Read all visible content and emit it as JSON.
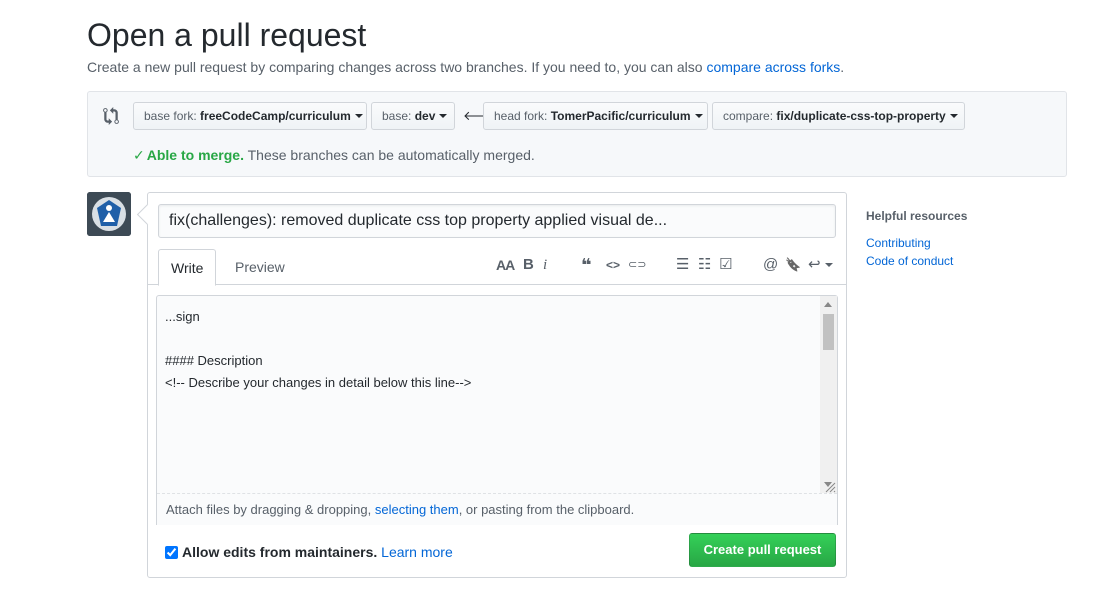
{
  "page": {
    "title": "Open a pull request",
    "subtitle_prefix": "Create a new pull request by comparing changes across two branches. If you need to, you can also ",
    "subtitle_link": "compare across forks",
    "subtitle_suffix": "."
  },
  "range": {
    "base_fork": {
      "label": "base fork:",
      "value": "freeCodeCamp/curriculum"
    },
    "base": {
      "label": "base:",
      "value": "dev"
    },
    "head_fork": {
      "label": "head fork:",
      "value": "TomerPacific/curriculum"
    },
    "compare": {
      "label": "compare:",
      "value": "fix/duplicate-css-top-property"
    },
    "merge_ok": "Able to merge.",
    "merge_text": " These branches can be automatically merged."
  },
  "composer": {
    "title_value": "fix(challenges): removed duplicate css top property applied visual de...",
    "tab_write": "Write",
    "tab_preview": "Preview",
    "toolbar": {
      "header": "AA",
      "bold": "B",
      "italic": "i",
      "quote": "❝",
      "code": "<>",
      "link": "⊂⊃",
      "bullet_list": "☰",
      "numbered_list": "☷",
      "task_list": "☑",
      "mention": "@",
      "reference": "🔖",
      "reply": "↩"
    },
    "body_value": "...sign\n\n#### Description\n<!-- Describe your changes in detail below this line-->",
    "attach_prefix": "Attach files by dragging & dropping, ",
    "attach_link": "selecting them",
    "attach_suffix": ", or pasting from the clipboard.",
    "allow_edits_label": "Allow edits from maintainers.",
    "allow_edits_checked": true,
    "learn_more": "Learn more",
    "create_button": "Create pull request"
  },
  "sidebar": {
    "heading": "Helpful resources",
    "links": [
      "Contributing",
      "Code of conduct"
    ]
  },
  "colors": {
    "link": "#0366d6",
    "success": "#28a745",
    "button_green": "#2cbe4e"
  }
}
